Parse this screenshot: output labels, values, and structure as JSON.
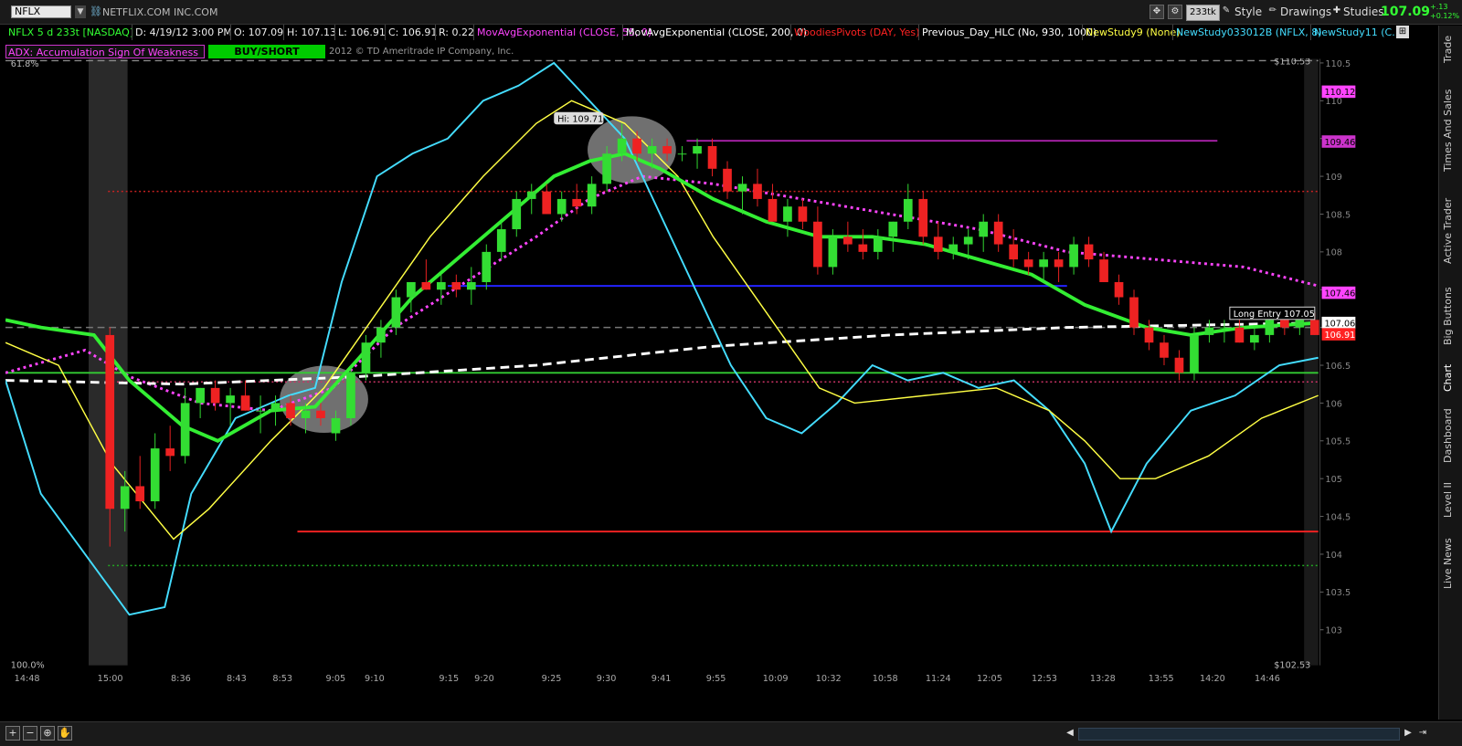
{
  "header": {
    "symbol": "NFLX",
    "company": "NETFLIX.COM INC.COM",
    "last_price": "107.09",
    "change_abs": "+.13",
    "change_pct": "+0.12%",
    "tick_badge": "233tk",
    "style_label": "Style",
    "drawings_label": "Drawings",
    "studies_label": "Studies"
  },
  "studybar": {
    "instrument": "NFLX 5 d 233t [NASDAQ]",
    "date": "D: 4/19/12 3:00 PM",
    "open": "O: 107.09",
    "high": "H: 107.13",
    "low": "L: 106.91",
    "close": "C: 106.91",
    "range": "R: 0.22",
    "studies": [
      {
        "label": "MovAvgExponential (CLOSE, 55, 0)",
        "color": "#ff44ff"
      },
      {
        "label": "MovAvgExponential (CLOSE, 200, 0)",
        "color": "#ffffff"
      },
      {
        "label": "WoodiesPivots (DAY, Yes)",
        "color": "#ff2222"
      },
      {
        "label": "Previous_Day_HLC (No, 930, 1000)",
        "color": "#ffffff"
      },
      {
        "label": "NewStudy9 (None)",
        "color": "#ffff44"
      },
      {
        "label": "NewStudy033012B (NFLX, 8)",
        "color": "#44ddff"
      },
      {
        "label": "NewStudy11 (C...",
        "color": "#44ddff"
      }
    ]
  },
  "signals": {
    "adx_label": "ADX: Accumulation Sign Of Weakness",
    "buy_short": "BUY/SHORT",
    "copyright": "2012 © TD Ameritrade IP Company, Inc."
  },
  "right_tabs": [
    "Trade",
    "Times And Sales",
    "Active Trader",
    "Big Buttons",
    "Chart",
    "Dashboard",
    "Level II",
    "Live News"
  ],
  "bottom": {
    "zoom_in": "+",
    "zoom_out": "−",
    "hand": "✋"
  },
  "chart_data": {
    "type": "line",
    "title": "",
    "ylim": [
      102.53,
      110.53
    ],
    "y_ticks": [
      103,
      103.5,
      104,
      104.5,
      105,
      105.5,
      106,
      106.5,
      107,
      107.5,
      108,
      108.5,
      109,
      109.5,
      110,
      110.5
    ],
    "x_ticks": [
      "14:48",
      "15:00",
      "8:36",
      "8:43",
      "8:53",
      "9:05",
      "9:10",
      "9:15",
      "9:20",
      "9:25",
      "9:30",
      "9:41",
      "9:55",
      "10:09",
      "10:32",
      "10:58",
      "11:24",
      "12:05",
      "12:53",
      "13:28",
      "13:55",
      "14:20",
      "14:46"
    ],
    "top_label": "61.8%",
    "bottom_label": "100.0%",
    "top_price_label": "$110.53",
    "bottom_price_label": "$102.53",
    "price_badges": [
      {
        "text": "110.12",
        "bg": "#ff44ff",
        "fg": "#000000",
        "y": 110.12
      },
      {
        "text": "109.46",
        "bg": "#cc33cc",
        "fg": "#000000",
        "y": 109.46
      },
      {
        "text": "107.46",
        "bg": "#ff44ff",
        "fg": "#000000",
        "y": 107.46
      },
      {
        "text": "107.06",
        "bg": "#ffffff",
        "fg": "#000000",
        "y": 107.06
      },
      {
        "text": "106.91",
        "bg": "#ff2222",
        "fg": "#ffffff",
        "y": 106.91
      }
    ],
    "annotations": [
      {
        "text": "Hi: 109.71"
      },
      {
        "text": "Long Entry 107.05"
      }
    ],
    "horizontal_levels": [
      {
        "name": "woodies-r1",
        "y": 108.8,
        "color": "#cc2222",
        "style": "dotted"
      },
      {
        "name": "magenta-high",
        "y": 109.47,
        "color": "#aa22aa",
        "style": "solid"
      },
      {
        "name": "blue-support",
        "y": 107.55,
        "color": "#2222ff",
        "style": "solid"
      },
      {
        "name": "green-pivot",
        "y": 106.4,
        "color": "#33cc33",
        "style": "solid"
      },
      {
        "name": "woodies-pivot",
        "y": 106.28,
        "color": "#cc3366",
        "style": "dotted"
      },
      {
        "name": "red-low",
        "y": 104.3,
        "color": "#ee2222",
        "style": "solid"
      },
      {
        "name": "green-s1",
        "y": 103.85,
        "color": "#22aa22",
        "style": "dotted"
      },
      {
        "name": "white-dash-top",
        "y": 110.53,
        "color": "#888888",
        "style": "dashed"
      },
      {
        "name": "gray-mid",
        "y": 107.0,
        "color": "#777777",
        "style": "dashed"
      }
    ],
    "candles": [
      [
        106.9,
        107.0,
        104.1,
        104.6
      ],
      [
        104.6,
        105.1,
        104.3,
        104.9
      ],
      [
        104.9,
        105.3,
        104.6,
        104.7
      ],
      [
        104.7,
        105.6,
        104.6,
        105.4
      ],
      [
        105.4,
        105.7,
        105.1,
        105.3
      ],
      [
        105.3,
        106.2,
        105.2,
        106.0
      ],
      [
        106.0,
        106.2,
        105.8,
        106.2
      ],
      [
        106.2,
        106.3,
        105.9,
        106.0
      ],
      [
        106.0,
        106.2,
        105.7,
        106.1
      ],
      [
        106.1,
        106.3,
        105.9,
        105.9
      ],
      [
        105.9,
        106.1,
        105.6,
        105.9
      ],
      [
        105.9,
        106.1,
        105.7,
        106.0
      ],
      [
        106.0,
        106.1,
        105.7,
        105.8
      ],
      [
        105.8,
        106.0,
        105.6,
        105.9
      ],
      [
        105.9,
        106.0,
        105.7,
        105.8
      ],
      [
        105.6,
        105.9,
        105.5,
        105.8
      ],
      [
        105.8,
        106.5,
        105.7,
        106.4
      ],
      [
        106.4,
        106.9,
        106.3,
        106.8
      ],
      [
        106.8,
        107.1,
        106.6,
        107.0
      ],
      [
        107.0,
        107.5,
        106.9,
        107.4
      ],
      [
        107.4,
        107.6,
        107.2,
        107.6
      ],
      [
        107.6,
        107.9,
        107.5,
        107.5
      ],
      [
        107.5,
        107.7,
        107.3,
        107.6
      ],
      [
        107.6,
        107.7,
        107.4,
        107.5
      ],
      [
        107.5,
        107.8,
        107.3,
        107.6
      ],
      [
        107.6,
        108.1,
        107.5,
        108.0
      ],
      [
        108.0,
        108.4,
        107.9,
        108.3
      ],
      [
        108.3,
        108.8,
        108.2,
        108.7
      ],
      [
        108.7,
        108.9,
        108.5,
        108.8
      ],
      [
        108.8,
        108.9,
        108.5,
        108.5
      ],
      [
        108.5,
        108.8,
        108.4,
        108.7
      ],
      [
        108.7,
        108.9,
        108.5,
        108.6
      ],
      [
        108.6,
        109.0,
        108.5,
        108.9
      ],
      [
        108.9,
        109.4,
        108.8,
        109.3
      ],
      [
        109.3,
        109.7,
        109.2,
        109.5
      ],
      [
        109.5,
        109.6,
        109.2,
        109.3
      ],
      [
        109.3,
        109.5,
        109.1,
        109.4
      ],
      [
        109.4,
        109.5,
        109.2,
        109.3
      ],
      [
        109.3,
        109.4,
        109.2,
        109.3
      ],
      [
        109.3,
        109.5,
        109.1,
        109.4
      ],
      [
        109.4,
        109.5,
        109.0,
        109.1
      ],
      [
        109.1,
        109.2,
        108.7,
        108.8
      ],
      [
        108.8,
        109.0,
        108.5,
        108.9
      ],
      [
        108.9,
        109.1,
        108.6,
        108.7
      ],
      [
        108.7,
        108.9,
        108.4,
        108.4
      ],
      [
        108.4,
        108.7,
        108.2,
        108.6
      ],
      [
        108.6,
        108.7,
        108.3,
        108.4
      ],
      [
        108.4,
        108.6,
        107.7,
        107.8
      ],
      [
        107.8,
        108.3,
        107.7,
        108.2
      ],
      [
        108.2,
        108.4,
        108.0,
        108.1
      ],
      [
        108.1,
        108.3,
        107.9,
        108.0
      ],
      [
        108.0,
        108.3,
        107.9,
        108.2
      ],
      [
        108.2,
        108.4,
        108.0,
        108.4
      ],
      [
        108.4,
        108.9,
        108.3,
        108.7
      ],
      [
        108.7,
        108.8,
        108.1,
        108.2
      ],
      [
        108.2,
        108.4,
        107.9,
        108.0
      ],
      [
        108.0,
        108.2,
        107.9,
        108.1
      ],
      [
        108.1,
        108.3,
        107.9,
        108.2
      ],
      [
        108.2,
        108.5,
        108.0,
        108.4
      ],
      [
        108.4,
        108.5,
        108.0,
        108.1
      ],
      [
        108.1,
        108.3,
        107.8,
        107.9
      ],
      [
        107.9,
        108.0,
        107.7,
        107.8
      ],
      [
        107.8,
        108.0,
        107.6,
        107.9
      ],
      [
        107.9,
        108.0,
        107.6,
        107.8
      ],
      [
        107.8,
        108.2,
        107.7,
        108.1
      ],
      [
        108.1,
        108.2,
        107.8,
        107.9
      ],
      [
        107.9,
        108.0,
        107.6,
        107.6
      ],
      [
        107.6,
        107.7,
        107.3,
        107.4
      ],
      [
        107.4,
        107.5,
        106.9,
        107.0
      ],
      [
        107.0,
        107.1,
        106.7,
        106.8
      ],
      [
        106.8,
        106.9,
        106.5,
        106.6
      ],
      [
        106.6,
        106.7,
        106.3,
        106.4
      ],
      [
        106.4,
        107.0,
        106.3,
        106.9
      ],
      [
        106.9,
        107.1,
        106.8,
        107.0
      ],
      [
        107.0,
        107.1,
        106.8,
        107.0
      ],
      [
        107.0,
        107.2,
        106.8,
        106.8
      ],
      [
        106.8,
        107.0,
        106.7,
        106.9
      ],
      [
        106.9,
        107.2,
        106.8,
        107.1
      ],
      [
        107.1,
        107.2,
        106.9,
        107.0
      ],
      [
        107.0,
        107.1,
        106.9,
        107.1
      ],
      [
        107.1,
        107.2,
        106.9,
        106.9
      ]
    ]
  }
}
